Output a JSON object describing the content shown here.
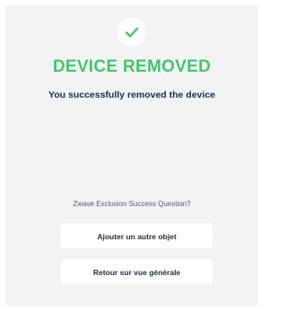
{
  "colors": {
    "success": "#41c76b",
    "card_background": "#f3f3f4",
    "text_dark": "#1f2d44"
  },
  "status": {
    "icon": "checkmark-icon",
    "title": "DEVICE REMOVED",
    "message": "You successfully removed the device"
  },
  "question": {
    "text": "Zwave Exclusion Success Question?"
  },
  "actions": {
    "add_another_label": "Ajouter un autre objet",
    "back_to_overview_label": "Retour sur vue générale"
  }
}
